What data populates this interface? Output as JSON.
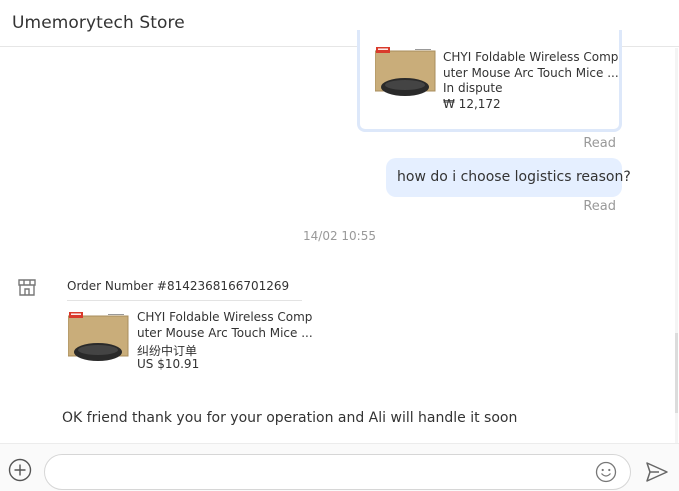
{
  "header": {
    "title": "Umemorytech Store"
  },
  "messages": {
    "outgoing_product": {
      "title_line1": "CHYI Foldable Wireless Comp",
      "title_line2": "uter Mouse Arc Touch Mice ...",
      "status": "In dispute",
      "price": "₩ 12,172",
      "read": "Read"
    },
    "outgoing_text": {
      "text": "how do i choose logistics reason?",
      "read": "Read"
    },
    "timestamp": "14/02 10:55",
    "incoming_order": {
      "order_number": "Order Number #8142368166701269",
      "title_line1": "CHYI Foldable Wireless Comp",
      "title_line2": "uter Mouse Arc Touch Mice ...",
      "status": "纠纷中订单",
      "price": "US $10.91"
    },
    "incoming_text": "OK friend thank you for your operation and Ali will handle it soon"
  },
  "composer": {
    "placeholder": "",
    "icons": {
      "add": "plus-circle-icon",
      "emoji": "smiley-icon",
      "send": "send-arrow-icon"
    }
  },
  "colors": {
    "outgoing_bubble": "#e5efff",
    "card_border": "#dde8fa",
    "muted_text": "#999999",
    "icon": "#555555"
  }
}
